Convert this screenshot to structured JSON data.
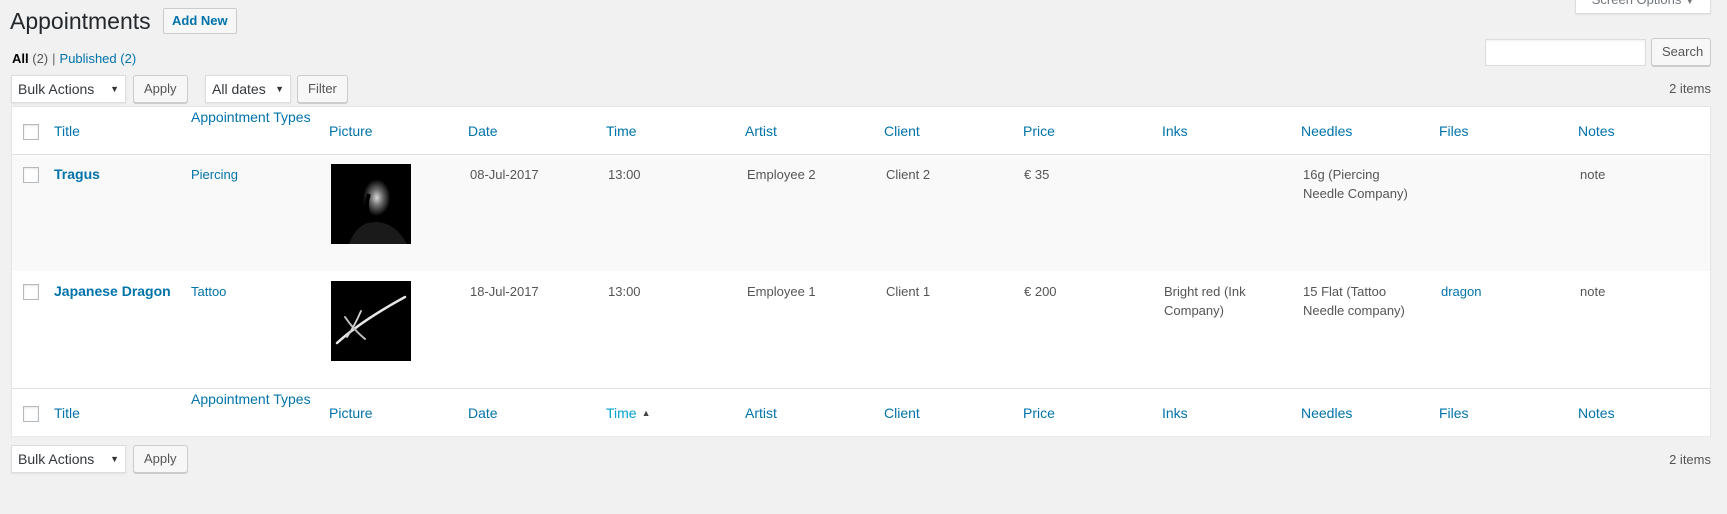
{
  "screen_options": {
    "label": "Screen Options",
    "icon": "caret-down-icon"
  },
  "header": {
    "title": "Appointments",
    "add_new_label": "Add New"
  },
  "views": [
    {
      "label": "All",
      "count": "(2)",
      "current": true
    },
    {
      "label": "Published",
      "count": "(2)",
      "current": false
    }
  ],
  "views_separator": "|",
  "search": {
    "placeholder": "",
    "value": "",
    "button_label": "Search"
  },
  "top_nav": {
    "bulk_actions": "Bulk Actions",
    "apply_label": "Apply",
    "date_filter": "All dates",
    "filter_label": "Filter",
    "items_count": "2 items"
  },
  "bottom_nav": {
    "bulk_actions": "Bulk Actions",
    "apply_label": "Apply",
    "items_count": "2 items"
  },
  "table": {
    "columns": [
      "Title",
      "Appointment Types",
      "Picture",
      "Date",
      "Time",
      "Artist",
      "Client",
      "Price",
      "Inks",
      "Needles",
      "Files",
      "Notes"
    ],
    "sorted_column": "Time",
    "sort_direction": "asc",
    "rows": [
      {
        "title": "Tragus",
        "type": "Piercing",
        "picture": "portrait-photo",
        "date": "08-Jul-2017",
        "time": "13:00",
        "artist": "Employee 2",
        "client": "Client 2",
        "price": "€ 35",
        "inks": "",
        "needles": "16g (Piercing Needle Company)",
        "files": "",
        "notes": "note"
      },
      {
        "title": "Japanese Dragon",
        "type": "Tattoo",
        "picture": "brush-stroke-image",
        "date": "18-Jul-2017",
        "time": "13:00",
        "artist": "Employee 1",
        "client": "Client 1",
        "price": "€ 200",
        "inks": "Bright red (Ink Company)",
        "needles": "15 Flat (Tattoo Needle company)",
        "files": "dragon",
        "notes": "note"
      }
    ]
  },
  "colors": {
    "link": "#0073aa",
    "link_hover": "#00a0d2",
    "background": "#f1f1f1",
    "alt_row": "#f9f9f9"
  }
}
